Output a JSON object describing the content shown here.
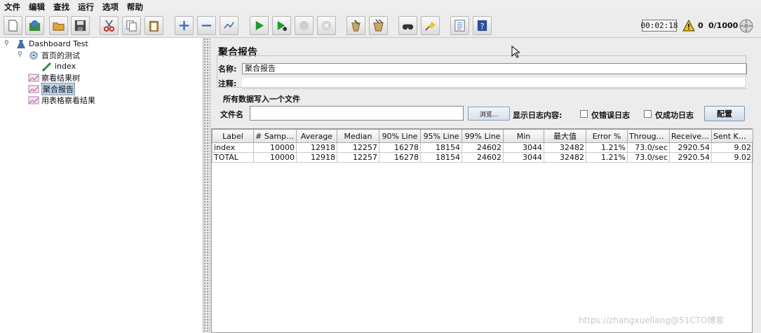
{
  "menu": [
    "文件",
    "编辑",
    "查找",
    "运行",
    "选项",
    "帮助"
  ],
  "toolbar": {
    "buttons": [
      "new-icon",
      "templates-icon",
      "open-icon",
      "save-icon",
      "cut-icon",
      "copy-icon",
      "paste-icon",
      "expand-icon",
      "collapse-icon",
      "toggle-icon",
      "start-icon",
      "start-no-pause-icon",
      "stop-icon",
      "shutdown-icon",
      "clear-icon",
      "clear-all-icon",
      "search-icon",
      "reset-search-icon",
      "function-helper-icon",
      "help-icon"
    ],
    "timer": "00:02:18",
    "warning_count": "0",
    "threads": "0/1000"
  },
  "tree": {
    "root": "Dashboard Test",
    "thread_group": "首页的测试",
    "sampler": "index",
    "listeners": [
      "察看结果树",
      "聚合报告",
      "用表格察看结果"
    ],
    "selected": "聚合报告"
  },
  "panel": {
    "title": "聚合报告",
    "name_label": "名称:",
    "name_value": "聚合报告",
    "comment_label": "注释:",
    "comment_value": "",
    "group_title": "所有数据写入一个文件",
    "file_label": "文件名",
    "file_value": "",
    "browse_label": "浏览...",
    "log_label": "显示日志内容:",
    "errors_only_label": "仅错误日志",
    "success_only_label": "仅成功日志",
    "config_label": "配置"
  },
  "table": {
    "columns": [
      "Label",
      "# Samples",
      "Average",
      "Median",
      "90% Line",
      "95% Line",
      "99% Line",
      "Min",
      "最大值",
      "Error %",
      "Through...",
      "Received...",
      "Sent KB/..."
    ],
    "rows": [
      [
        "index",
        "10000",
        "12918",
        "12257",
        "16278",
        "18154",
        "24602",
        "3044",
        "32482",
        "1.21%",
        "73.0/sec",
        "2920.54",
        "9.02"
      ],
      [
        "TOTAL",
        "10000",
        "12918",
        "12257",
        "16278",
        "18154",
        "24602",
        "3044",
        "32482",
        "1.21%",
        "73.0/sec",
        "2920.54",
        "9.02"
      ]
    ]
  },
  "watermark": "https://zhangxuellang@51CTO博客"
}
